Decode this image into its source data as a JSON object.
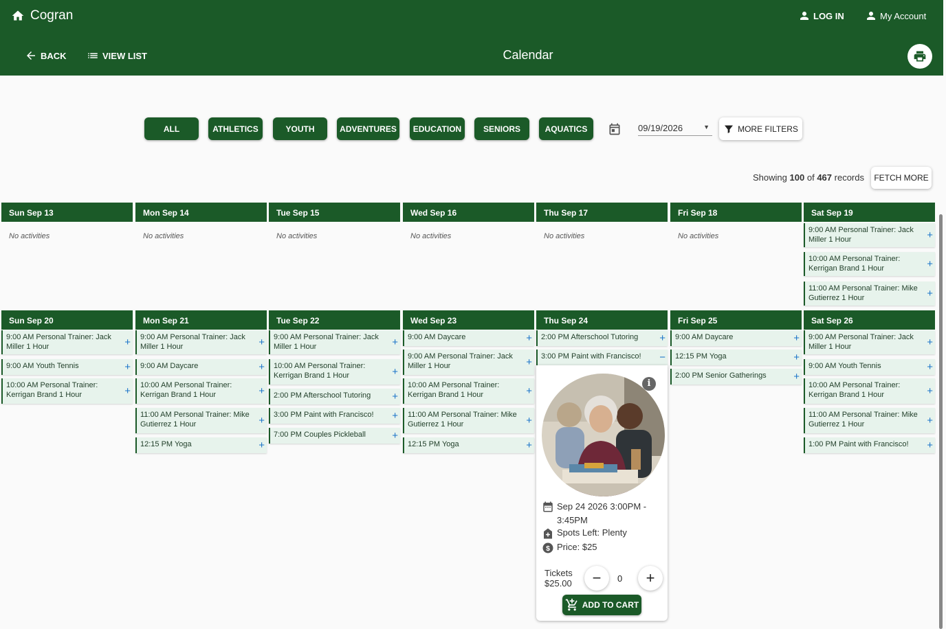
{
  "header": {
    "brand": "Cogran",
    "log_in": "LOG IN",
    "my_account": "My Account",
    "back": "BACK",
    "view_list": "VIEW LIST",
    "title": "Calendar",
    "icons": [
      "home-icon",
      "person-icon",
      "arrow-back-icon",
      "list-icon",
      "print-icon"
    ]
  },
  "filters": {
    "categories": [
      "ALL",
      "ATHLETICS",
      "YOUTH",
      "ADVENTURES",
      "EDUCATION",
      "SENIORS",
      "AQUATICS"
    ],
    "date": "09/19/2026",
    "more_filters": "MORE FILTERS"
  },
  "records": {
    "prefix": "Showing",
    "shown": "100",
    "of": "of",
    "total": "467",
    "suffix": "records",
    "fetch_more": "FETCH MORE"
  },
  "no_activities": "No activities",
  "weeks": [
    {
      "days": [
        {
          "label": "Sun Sep 13",
          "events": []
        },
        {
          "label": "Mon Sep 14",
          "events": []
        },
        {
          "label": "Tue Sep 15",
          "events": []
        },
        {
          "label": "Wed Sep 16",
          "events": []
        },
        {
          "label": "Thu Sep 17",
          "events": []
        },
        {
          "label": "Fri Sep 18",
          "events": []
        },
        {
          "label": "Sat Sep 19",
          "events": [
            "9:00 AM Personal Trainer: Jack Miller 1 Hour",
            "10:00 AM Personal Trainer: Kerrigan Brand 1 Hour",
            "11:00 AM Personal Trainer: Mike Gutierrez 1 Hour"
          ]
        }
      ]
    },
    {
      "days": [
        {
          "label": "Sun Sep 20",
          "events": [
            "9:00 AM Personal Trainer: Jack Miller 1 Hour",
            "9:00 AM Youth Tennis",
            "10:00 AM Personal Trainer: Kerrigan Brand 1 Hour"
          ]
        },
        {
          "label": "Mon Sep 21",
          "events": [
            "9:00 AM Personal Trainer: Jack Miller 1 Hour",
            "9:00 AM Daycare",
            "10:00 AM Personal Trainer: Kerrigan Brand 1 Hour",
            "11:00 AM Personal Trainer: Mike Gutierrez 1 Hour",
            "12:15 PM Yoga"
          ]
        },
        {
          "label": "Tue Sep 22",
          "events": [
            "9:00 AM Personal Trainer: Jack Miller 1 Hour",
            "10:00 AM Personal Trainer: Kerrigan Brand 1 Hour",
            "2:00 PM Afterschool Tutoring",
            "3:00 PM Paint with Francisco!",
            "7:00 PM Couples Pickleball"
          ]
        },
        {
          "label": "Wed Sep 23",
          "events": [
            "9:00 AM Daycare",
            "9:00 AM Personal Trainer: Jack Miller 1 Hour",
            "10:00 AM Personal Trainer: Kerrigan Brand 1 Hour",
            "11:00 AM Personal Trainer: Mike Gutierrez 1 Hour",
            "12:15 PM Yoga"
          ]
        },
        {
          "label": "Thu Sep 24",
          "events": [
            "2:00 PM Afterschool Tutoring",
            "3:00 PM Paint with Francisco!"
          ]
        },
        {
          "label": "Fri Sep 25",
          "events": [
            "9:00 AM Daycare",
            "12:15 PM Yoga",
            "2:00 PM Senior Gatherings"
          ]
        },
        {
          "label": "Sat Sep 26",
          "events": [
            "9:00 AM Personal Trainer: Jack Miller 1 Hour",
            "9:00 AM Youth Tennis",
            "10:00 AM Personal Trainer: Kerrigan Brand 1 Hour",
            "11:00 AM Personal Trainer: Mike Gutierrez 1 Hour",
            "1:00 PM Paint with Francisco!"
          ]
        }
      ]
    }
  ],
  "popup": {
    "datetime": "Sep 24 2026 3:00PM - 3:45PM",
    "spots": "Spots Left: Plenty",
    "price": "Price: $25",
    "tickets_label": "Tickets",
    "tickets_price": "$25.00",
    "quantity": "0",
    "add_to_cart": "ADD TO CART"
  },
  "colors": {
    "primary": "#1b5a28",
    "event_bg": "#e7f3ec",
    "plus": "#1a73c9"
  }
}
